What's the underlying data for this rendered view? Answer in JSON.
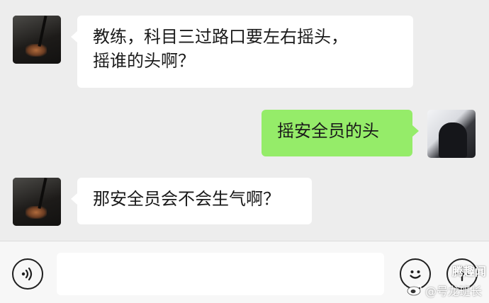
{
  "messages": [
    {
      "side": "left",
      "text_line1": "教练，科目三过路口要左右摇头，",
      "text_line2": "摇谁的头啊？"
    },
    {
      "side": "right",
      "text": "摇安全员的头"
    },
    {
      "side": "left",
      "text": "那安全员会不会生气啊？"
    }
  ],
  "input_bar": {
    "voice_icon": "voice-icon",
    "emoji_icon": "emoji-icon",
    "plus_icon": "plus-icon",
    "text_value": ""
  },
  "watermark": {
    "line1": "腾趣闻",
    "line2": "@号龙班长"
  },
  "colors": {
    "background": "#ededed",
    "sent_bubble": "#95ec69",
    "received_bubble": "#ffffff"
  }
}
